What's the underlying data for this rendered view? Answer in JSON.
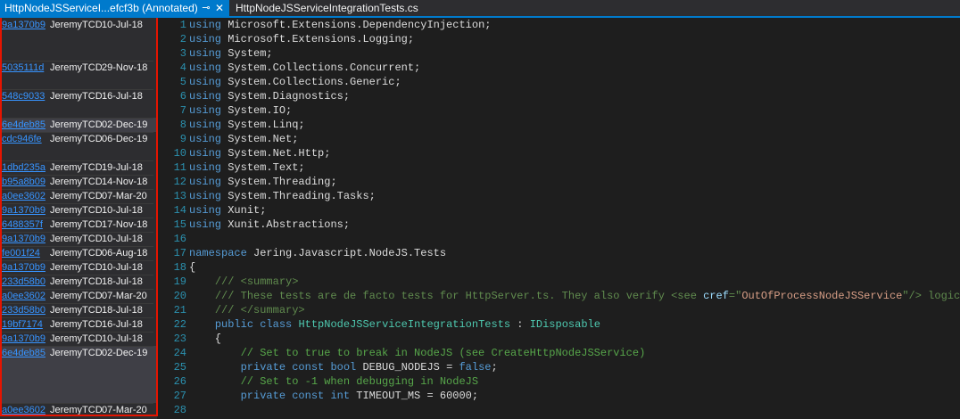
{
  "tabs": [
    {
      "label": "HttpNodeJSServiceI...efcf3b (Annotated)",
      "active": true
    },
    {
      "label": "HttpNodeJSServiceIntegrationTests.cs",
      "active": false
    }
  ],
  "tab_icons": {
    "pin": "pin-icon",
    "close": "close-icon"
  },
  "annotations": [
    {
      "hash": "9a1370b9",
      "author": "JeremyTCD",
      "date": "10-Jul-18"
    },
    {
      "hash": "5035111d",
      "author": "JeremyTCD",
      "date": "29-Nov-18"
    },
    {
      "hash": "548c9033",
      "author": "JeremyTCD",
      "date": "16-Jul-18"
    },
    {
      "hash": "6e4deb85",
      "author": "JeremyTCD",
      "date": "02-Dec-19"
    },
    {
      "hash": "cdc946fe",
      "author": "JeremyTCD",
      "date": "06-Dec-19"
    },
    {
      "hash": "1dbd235a",
      "author": "JeremyTCD",
      "date": "19-Jul-18"
    },
    {
      "hash": "b95a8b09",
      "author": "JeremyTCD",
      "date": "14-Nov-18"
    },
    {
      "hash": "a0ee3602",
      "author": "JeremyTCD",
      "date": "07-Mar-20"
    },
    {
      "hash": "9a1370b9",
      "author": "JeremyTCD",
      "date": "10-Jul-18"
    },
    {
      "hash": "6488357f",
      "author": "JeremyTCD",
      "date": "17-Nov-18"
    },
    {
      "hash": "9a1370b9",
      "author": "JeremyTCD",
      "date": "10-Jul-18"
    },
    {
      "hash": "fe001f24",
      "author": "JeremyTCD",
      "date": "06-Aug-18"
    },
    {
      "hash": "9a1370b9",
      "author": "JeremyTCD",
      "date": "10-Jul-18"
    },
    {
      "hash": "233d58b0",
      "author": "JeremyTCD",
      "date": "18-Jul-18"
    },
    {
      "hash": "a0ee3602",
      "author": "JeremyTCD",
      "date": "07-Mar-20"
    },
    {
      "hash": "233d58b0",
      "author": "JeremyTCD",
      "date": "18-Jul-18"
    },
    {
      "hash": "19bf7174",
      "author": "JeremyTCD",
      "date": "16-Jul-18"
    },
    {
      "hash": "9a1370b9",
      "author": "JeremyTCD",
      "date": "10-Jul-18"
    },
    {
      "hash": "6e4deb85",
      "author": "JeremyTCD",
      "date": "02-Dec-19"
    },
    {
      "hash": "a0ee3602",
      "author": "JeremyTCD",
      "date": "07-Mar-20"
    }
  ],
  "code_lines": [
    [
      {
        "t": "using ",
        "c": "kw"
      },
      {
        "t": "Microsoft.Extensions.DependencyInjection;",
        "c": ""
      }
    ],
    [
      {
        "t": "using ",
        "c": "kw"
      },
      {
        "t": "Microsoft.Extensions.Logging;",
        "c": ""
      }
    ],
    [
      {
        "t": "using ",
        "c": "kw"
      },
      {
        "t": "System;",
        "c": ""
      }
    ],
    [
      {
        "t": "using ",
        "c": "kw"
      },
      {
        "t": "System.Collections.Concurrent;",
        "c": ""
      }
    ],
    [
      {
        "t": "using ",
        "c": "kw"
      },
      {
        "t": "System.Collections.Generic;",
        "c": ""
      }
    ],
    [
      {
        "t": "using ",
        "c": "kw"
      },
      {
        "t": "System.Diagnostics;",
        "c": ""
      }
    ],
    [
      {
        "t": "using ",
        "c": "kw"
      },
      {
        "t": "System.IO;",
        "c": ""
      }
    ],
    [
      {
        "t": "using ",
        "c": "kw"
      },
      {
        "t": "System.Linq;",
        "c": ""
      }
    ],
    [
      {
        "t": "using ",
        "c": "kw"
      },
      {
        "t": "System.Net;",
        "c": ""
      }
    ],
    [
      {
        "t": "using ",
        "c": "kw"
      },
      {
        "t": "System.Net.Http;",
        "c": ""
      }
    ],
    [
      {
        "t": "using ",
        "c": "kw"
      },
      {
        "t": "System.Text;",
        "c": ""
      }
    ],
    [
      {
        "t": "using ",
        "c": "kw"
      },
      {
        "t": "System.Threading;",
        "c": ""
      }
    ],
    [
      {
        "t": "using ",
        "c": "kw"
      },
      {
        "t": "System.Threading.Tasks;",
        "c": ""
      }
    ],
    [
      {
        "t": "using ",
        "c": "kw"
      },
      {
        "t": "Xunit;",
        "c": ""
      }
    ],
    [
      {
        "t": "using ",
        "c": "kw"
      },
      {
        "t": "Xunit.Abstractions;",
        "c": ""
      }
    ],
    [],
    [
      {
        "t": "namespace ",
        "c": "kw"
      },
      {
        "t": "Jering.Javascript.NodeJS.Tests",
        "c": ""
      }
    ],
    [
      {
        "t": "{",
        "c": ""
      }
    ],
    [
      {
        "t": "    ",
        "c": ""
      },
      {
        "t": "/// <summary>",
        "c": "xd"
      }
    ],
    [
      {
        "t": "    ",
        "c": ""
      },
      {
        "t": "/// These tests are de facto tests for HttpServer.ts. They also verify <see ",
        "c": "xd"
      },
      {
        "t": "cref",
        "c": "xa"
      },
      {
        "t": "=\"",
        "c": "xd"
      },
      {
        "t": "OutOfProcessNodeJSService",
        "c": "xs"
      },
      {
        "t": "\"/> logic.",
        "c": "xd"
      }
    ],
    [
      {
        "t": "    ",
        "c": ""
      },
      {
        "t": "/// </summary>",
        "c": "xd"
      }
    ],
    [
      {
        "t": "    ",
        "c": ""
      },
      {
        "t": "public ",
        "c": "kw"
      },
      {
        "t": "class ",
        "c": "kw"
      },
      {
        "t": "HttpNodeJSServiceIntegrationTests",
        "c": "ty"
      },
      {
        "t": " : ",
        "c": ""
      },
      {
        "t": "IDisposable",
        "c": "ty"
      }
    ],
    [
      {
        "t": "    {",
        "c": ""
      }
    ],
    [
      {
        "t": "        ",
        "c": ""
      },
      {
        "t": "// Set to true to break in NodeJS (see CreateHttpNodeJSService)",
        "c": "cm"
      }
    ],
    [
      {
        "t": "        ",
        "c": ""
      },
      {
        "t": "private ",
        "c": "kw"
      },
      {
        "t": "const ",
        "c": "kw"
      },
      {
        "t": "bool ",
        "c": "kw"
      },
      {
        "t": "DEBUG_NODEJS = ",
        "c": ""
      },
      {
        "t": "false",
        "c": "kw"
      },
      {
        "t": ";",
        "c": ""
      }
    ],
    [
      {
        "t": "        ",
        "c": ""
      },
      {
        "t": "// Set to -1 when debugging in NodeJS",
        "c": "cm"
      }
    ],
    [
      {
        "t": "        ",
        "c": ""
      },
      {
        "t": "private ",
        "c": "kw"
      },
      {
        "t": "const ",
        "c": "kw"
      },
      {
        "t": "int ",
        "c": "kw"
      },
      {
        "t": "TIMEOUT_MS = 60000;",
        "c": ""
      }
    ],
    []
  ],
  "line_number_start": 1
}
